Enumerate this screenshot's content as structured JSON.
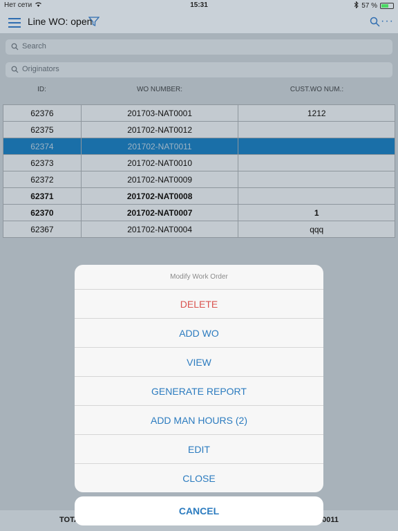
{
  "status_bar": {
    "carrier": "Нет сети",
    "time": "15:31",
    "battery_text": "57 %",
    "battery_level": 0.57
  },
  "nav": {
    "title": "Line WO: open",
    "more": "···"
  },
  "search": {
    "placeholder": "Search"
  },
  "originators": {
    "placeholder": "Originators"
  },
  "columns": {
    "id": "ID:",
    "wo_number": "WO NUMBER:",
    "cust_wo": "CUST.WO NUM.:"
  },
  "rows": [
    {
      "id": "62376",
      "wo": "201703-NAT0001",
      "cust": "1212",
      "selected": false,
      "bold": false
    },
    {
      "id": "62375",
      "wo": "201702-NAT0012",
      "cust": "",
      "selected": false,
      "bold": false
    },
    {
      "id": "62374",
      "wo": "201702-NAT0011",
      "cust": "",
      "selected": true,
      "bold": false
    },
    {
      "id": "62373",
      "wo": "201702-NAT0010",
      "cust": "",
      "selected": false,
      "bold": false
    },
    {
      "id": "62372",
      "wo": "201702-NAT0009",
      "cust": "",
      "selected": false,
      "bold": false
    },
    {
      "id": "62371",
      "wo": "201702-NAT0008",
      "cust": "",
      "selected": false,
      "bold": true
    },
    {
      "id": "62370",
      "wo": "201702-NAT0007",
      "cust": "1",
      "selected": false,
      "bold": true
    },
    {
      "id": "62367",
      "wo": "201702-NAT0004",
      "cust": "qqq",
      "selected": false,
      "bold": false
    }
  ],
  "bottom": {
    "left": "TOTA",
    "right": "0011"
  },
  "action_sheet": {
    "title": "Modify Work Order",
    "items": [
      "DELETE",
      "ADD WO",
      "VIEW",
      "GENERATE REPORT",
      "ADD MAN HOURS (2)",
      "EDIT",
      "CLOSE"
    ],
    "cancel": "CANCEL"
  },
  "colors": {
    "accent": "#2b7bbf",
    "destructive": "#d9534f",
    "selected_row": "#1a6fa8"
  }
}
